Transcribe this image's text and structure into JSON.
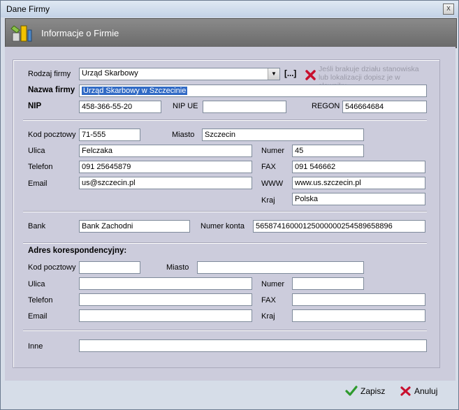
{
  "window": {
    "title": "Dane Firmy",
    "close_label": "x"
  },
  "header": {
    "title": "Informacje o Firmie"
  },
  "company": {
    "type_label": "Rodzaj firmy",
    "type_value": "Urząd Skarbowy",
    "browse_label": "[...]",
    "hint": "Jeśli brakuje działu stanowiska lub lokalizacji dopisz je w słowniku",
    "name_label": "Nazwa firmy",
    "name_value": "Urząd Skarbowy w Szczecinie",
    "nip_label": "NIP",
    "nip_value": "458-366-55-20",
    "nipue_label": "NIP UE",
    "nipue_value": "",
    "regon_label": "REGON",
    "regon_value": "546664684"
  },
  "address": {
    "postal_label": "Kod pocztowy",
    "postal_value": "71-555",
    "city_label": "Miasto",
    "city_value": "Szczecin",
    "street_label": "Ulica",
    "street_value": "Felczaka",
    "number_label": "Numer",
    "number_value": "45",
    "phone_label": "Telefon",
    "phone_value": "091 25645879",
    "fax_label": "FAX",
    "fax_value": "091 546662",
    "email_label": "Email",
    "email_value": "us@szczecin.pl",
    "www_label": "WWW",
    "www_value": "www.us.szczecin.pl",
    "country_label": "Kraj",
    "country_value": "Polska"
  },
  "bank": {
    "bank_label": "Bank",
    "bank_value": "Bank Zachodni",
    "account_label": "Numer konta",
    "account_value": "56587416000125000000254589658896"
  },
  "correspondence": {
    "heading": "Adres korespondencyjny:",
    "postal_label": "Kod pocztowy",
    "postal_value": "",
    "city_label": "Miasto",
    "city_value": "",
    "street_label": "Ulica",
    "street_value": "",
    "number_label": "Numer",
    "number_value": "",
    "phone_label": "Telefon",
    "phone_value": "",
    "fax_label": "FAX",
    "fax_value": "",
    "email_label": "Email",
    "email_value": "",
    "country_label": "Kraj",
    "country_value": ""
  },
  "other": {
    "label": "Inne",
    "value": ""
  },
  "buttons": {
    "save_label": "Zapisz",
    "cancel_label": "Anuluj"
  },
  "icons": {
    "save": "check-icon",
    "cancel": "x-icon",
    "header": "tools-icon"
  }
}
